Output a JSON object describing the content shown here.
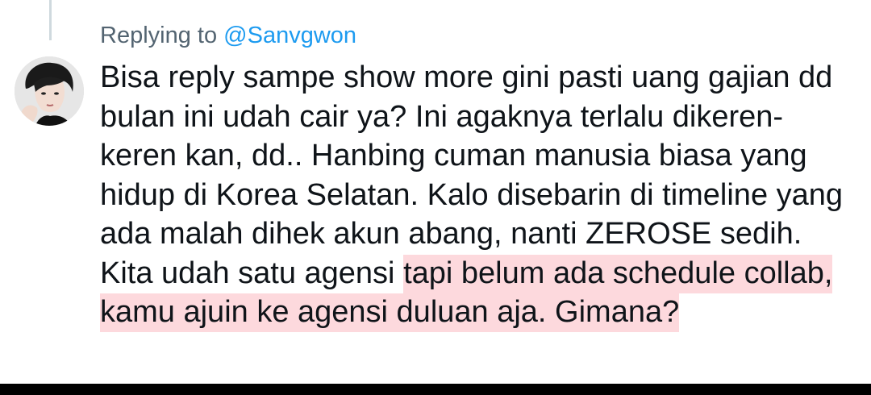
{
  "reply_context": {
    "prefix": "Replying to ",
    "mention": "@Sanvgwon"
  },
  "avatar": {
    "icon": "user-avatar-photo"
  },
  "tweet": {
    "text_plain": "Bisa reply sampe show more gini pasti uang gajian dd bulan ini udah cair ya? Ini agaknya terlalu dikeren-keren kan, dd.. Hanbing cuman manusia biasa yang hidup di Korea Selatan. Kalo disebarin di timeline yang ada malah dihek akun abang, nanti ZEROSE sedih. Kita udah satu agensi ",
    "text_highlighted": "tapi belum ada schedule collab, kamu ajuin ke agensi duluan aja. Gimana?"
  },
  "colors": {
    "text": "#0f1419",
    "secondary": "#536471",
    "link": "#1d9bf0",
    "highlight": "#fdd9dd",
    "thread_line": "#cfd9de"
  }
}
